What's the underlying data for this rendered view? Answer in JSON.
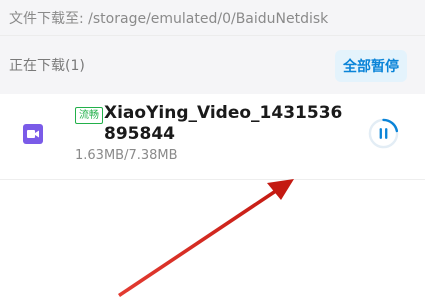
{
  "path_bar": {
    "text": "文件下载至: /storage/emulated/0/BaiduNetdisk"
  },
  "section": {
    "title": "正在下载(1)",
    "pause_all_label": "全部暂停"
  },
  "download_item": {
    "badge": "流畅",
    "filename": "XiaoYing_Video_1431536895844",
    "size": "1.63MB/7.38MB",
    "progress_fraction": 0.22
  },
  "colors": {
    "accent": "#0a84d8",
    "badge": "#22b04a",
    "file_icon": "#7a5be8",
    "arrow": "#e0261b"
  },
  "icons": {
    "file": "video-file-icon",
    "action": "pause-progress-icon"
  }
}
